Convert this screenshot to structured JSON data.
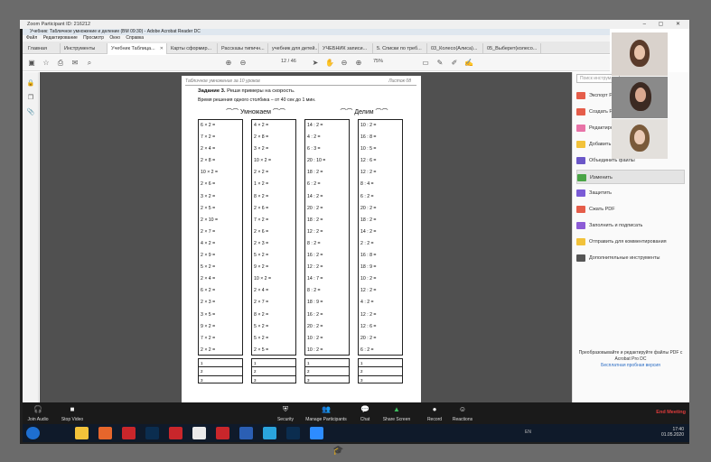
{
  "zoom": {
    "title": "Zoom Participant ID: 216212",
    "controls": [
      {
        "label": "Join Audio",
        "icon": "headphones-icon",
        "glyph": "🎧"
      },
      {
        "label": "Stop Video",
        "icon": "camera-icon",
        "glyph": "■"
      },
      {
        "label": "Security",
        "icon": "shield-icon",
        "glyph": "⛨"
      },
      {
        "label": "Manage Participants",
        "icon": "people-icon",
        "glyph": "👥"
      },
      {
        "label": "Chat",
        "icon": "chat-icon",
        "glyph": "💬"
      },
      {
        "label": "Share Screen",
        "icon": "share-screen-icon",
        "glyph": "▲"
      },
      {
        "label": "Record",
        "icon": "record-icon",
        "glyph": "●"
      },
      {
        "label": "Reactions",
        "icon": "reactions-icon",
        "glyph": "☺"
      }
    ],
    "end_meeting": "End Meeting"
  },
  "acrobat": {
    "title": "Учебник: Табличное умножение и деление (ВМ 09:30) - Adobe Acrobat Reader DC",
    "menu": [
      "Файл",
      "Редактирование",
      "Просмотр",
      "Окно",
      "Справка"
    ],
    "tabs": [
      "Главная",
      "Инструменты",
      "Учебник Таблица...",
      "Карты сформир...",
      "Рассказы типичн...",
      "учебник для детей...",
      "УЧЕБНИК записи...",
      "5. Списки по треб...",
      "03_Колесо(Алиса)...",
      "05_Выберет(колесо..."
    ],
    "page_current": "12",
    "page_total": "/ 46",
    "zoom_value": "75%",
    "right_tools": [
      "Экспорт PDF",
      "Создать PDF",
      "Редактировать PDF",
      "Добавить комментарий",
      "Объединить файлы",
      "Изменить",
      "Защитить",
      "Сжать PDF",
      "Заполнить и подписать",
      "Отправить для комментирования",
      "Дополнительные инструменты"
    ],
    "search_placeholder": "Поиск инструм...",
    "promo_text": "Преобразовывайте и редактируйте файлы PDF с Acrobat Pro DC",
    "promo_link": "Бесплатная пробная версия"
  },
  "worksheet": {
    "header_left": "Табличное умножение за 10 уроков",
    "header_right": "Листок 08",
    "task_label": "Задание 3.",
    "task_text": " Реши примеры на скорость.",
    "time_text": "Время решения одного столбика – от 40 сек до 1 мин.",
    "multiply_label": "Умножаем",
    "divide_label": "Делим",
    "col1": [
      "6 × 2 =",
      "7 × 2 =",
      "2 × 4 =",
      "2 × 8 =",
      "10 × 2 =",
      "2 × 6 =",
      "3 × 2 =",
      "2 × 5 =",
      "2 × 10 =",
      "2 × 7 =",
      "4 × 2 =",
      "2 × 9 =",
      "5 × 2 =",
      "2 × 4 =",
      "6 × 2 =",
      "2 × 3 =",
      "3 × 5 =",
      "9 × 2 =",
      "7 × 2 =",
      "2 × 2 ="
    ],
    "col2": [
      "4 × 2 =",
      "2 × 8 =",
      "3 × 2 =",
      "10 × 2 =",
      "2 × 2 =",
      "1 × 2 =",
      "8 × 2 =",
      "2 × 6 =",
      "7 × 2 =",
      "2 × 6 =",
      "2 × 3 =",
      "5 × 2 =",
      "9 × 2 =",
      "10 × 2 =",
      "2 × 4 =",
      "2 × 7 =",
      "8 × 2 =",
      "5 × 2 =",
      "5 × 2 =",
      "2 × 5 ="
    ],
    "col3": [
      "14 : 2 =",
      "4 : 2 =",
      "6 : 3 =",
      "20 : 10 =",
      "18 : 2 =",
      "6 : 2 =",
      "14 : 2 =",
      "20 : 2 =",
      "18 : 2 =",
      "12 : 2 =",
      "8 : 2 =",
      "16 : 2 =",
      "12 : 2 =",
      "14 : 7 =",
      "8 : 2 =",
      "18 : 9 =",
      "16 : 2 =",
      "20 : 2 =",
      "10 : 2 =",
      "10 : 2 ="
    ],
    "col4": [
      "10 : 2 =",
      "16 : 8 =",
      "10 : 5 =",
      "12 : 6 =",
      "12 : 2 =",
      "8 : 4 =",
      "6 : 2 =",
      "20 : 2 =",
      "18 : 2 =",
      "14 : 2 =",
      "2 : 2 =",
      "16 : 8 =",
      "18 : 9 =",
      "10 : 2 =",
      "12 : 2 =",
      "4 : 2 =",
      "12 : 2 =",
      "12 : 6 =",
      "20 : 2 =",
      "6 : 2 ="
    ],
    "answer_rows": [
      "1",
      "2",
      "3"
    ]
  },
  "taskbar": {
    "lang": "EN",
    "time": "17:40",
    "date": "01.05.2020"
  }
}
